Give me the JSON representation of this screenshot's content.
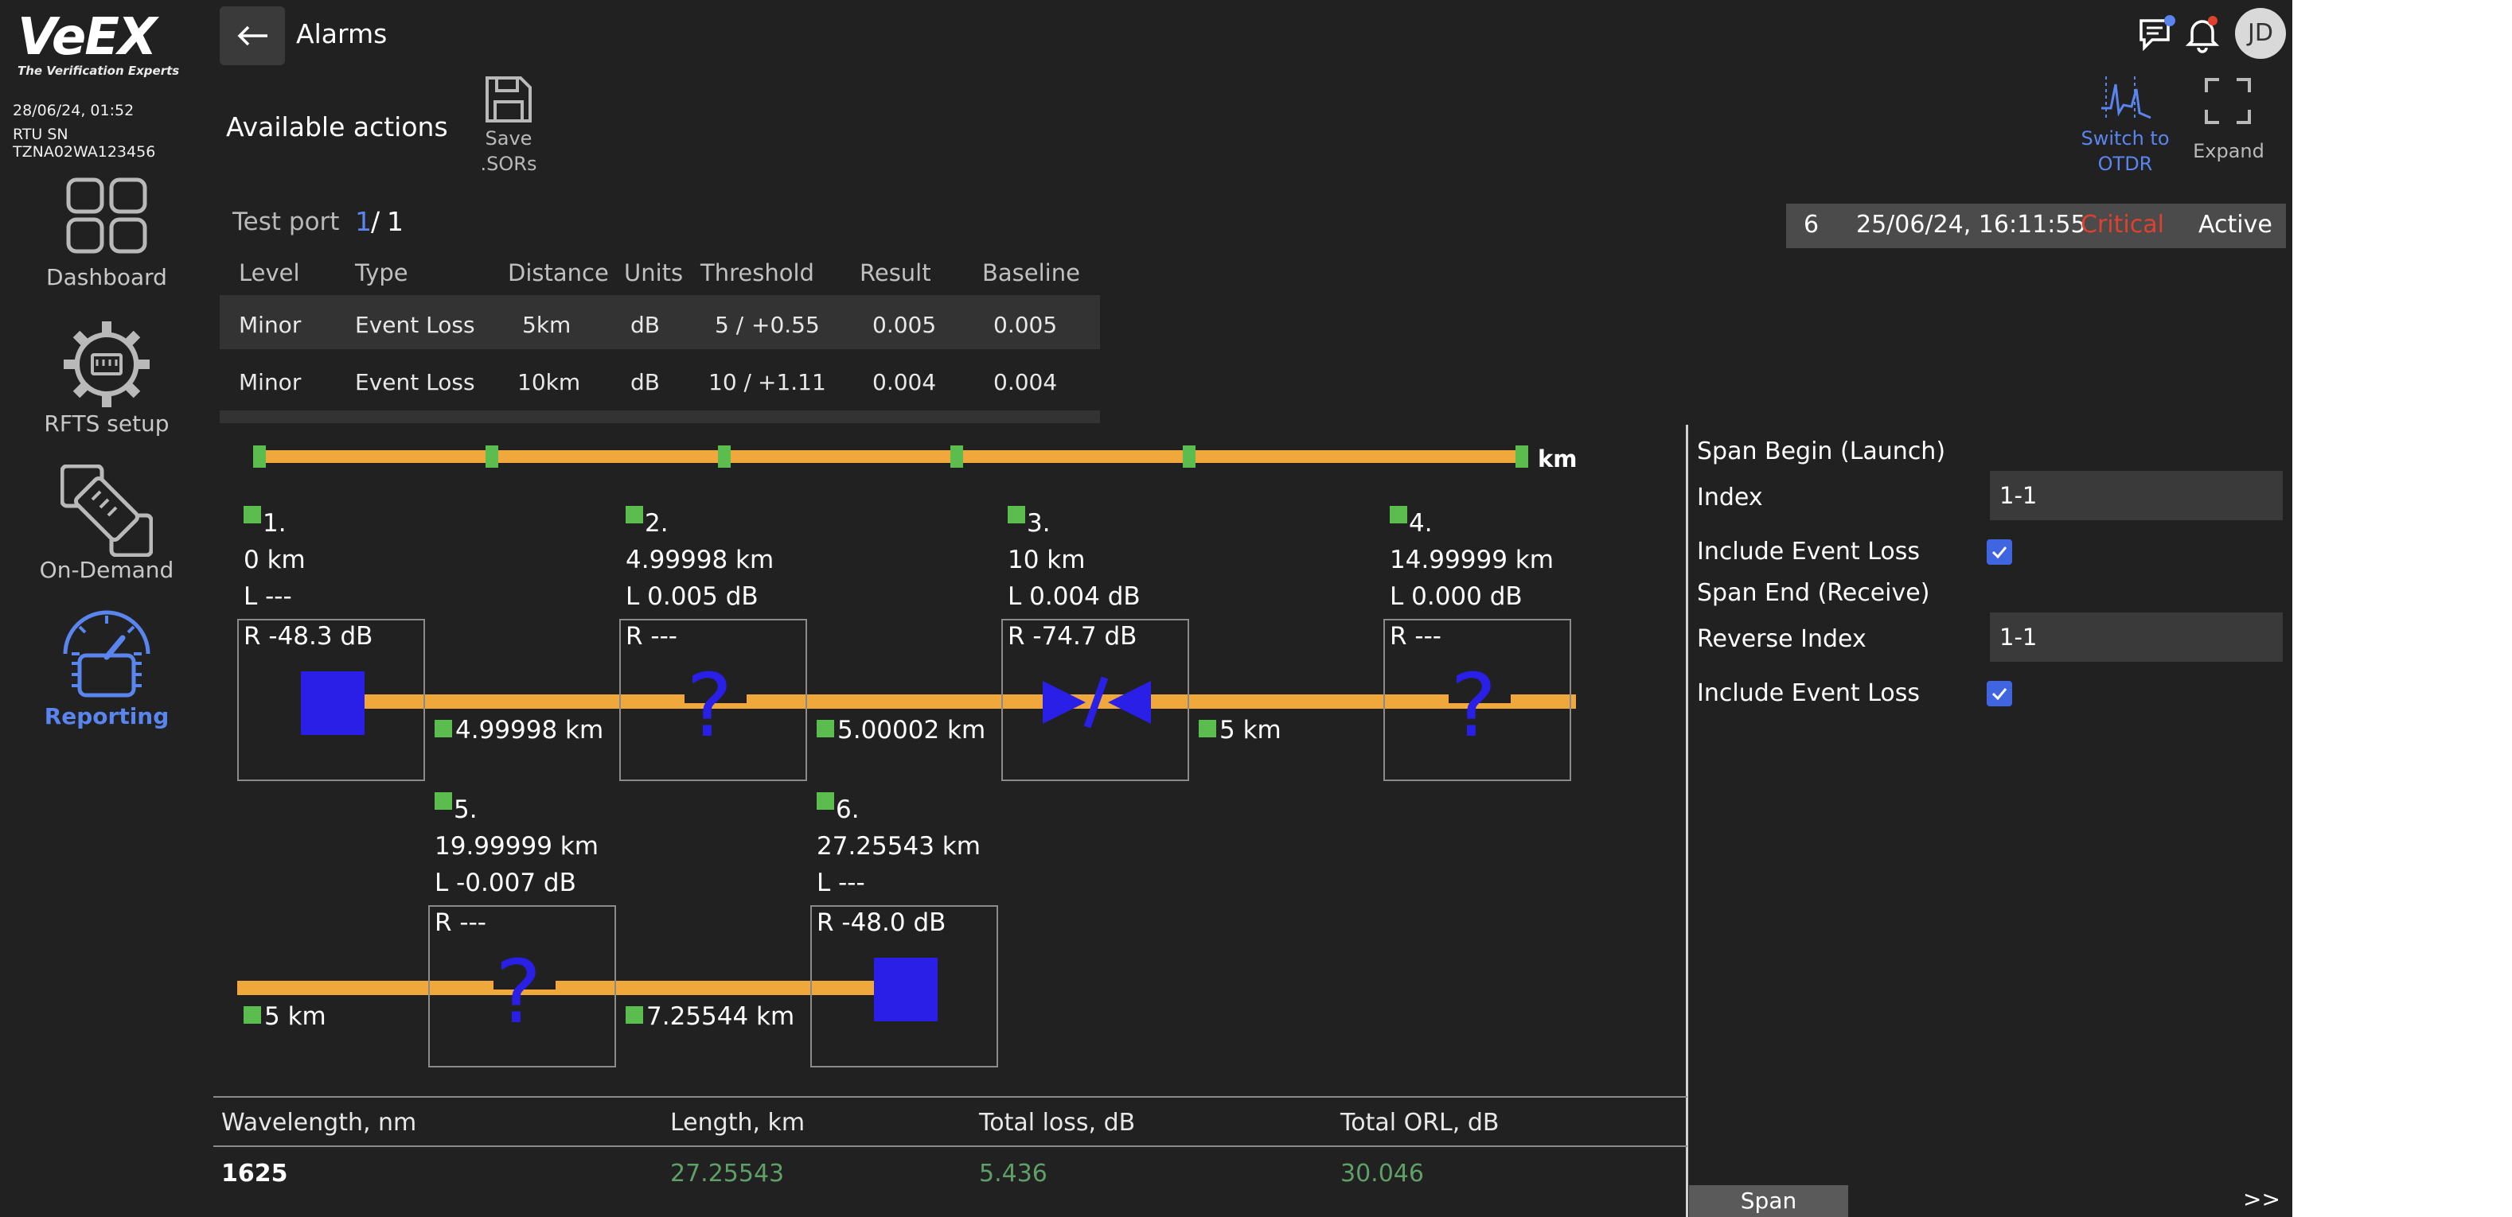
{
  "brand": {
    "logo": "VeEX",
    "tagline": "The Verification Experts"
  },
  "device": {
    "datetime": "28/06/24, 01:52",
    "serial": "RTU SN TZNA02WA123456"
  },
  "nav": [
    {
      "label": "Dashboard",
      "icon": "dashboard-icon"
    },
    {
      "label": "RFTS setup",
      "icon": "gear-icon"
    },
    {
      "label": "On-Demand",
      "icon": "on-demand-icon"
    },
    {
      "label": "Reporting",
      "icon": "speedometer-icon",
      "active": true
    }
  ],
  "header": {
    "back_icon": "arrow-left-icon",
    "title": "Alarms",
    "avatar": "JD"
  },
  "actions": {
    "title": "Available actions",
    "save_label_1": "Save",
    "save_label_2": ".SORs",
    "switch_label_1": "Switch to",
    "switch_label_2": "OTDR",
    "expand_label": "Expand"
  },
  "test_port": {
    "label": "Test port",
    "current": "1",
    "sep": "/",
    "total": "1"
  },
  "alarm_table": {
    "headers": [
      "Level",
      "Type",
      "Distance",
      "Units",
      "Threshold",
      "Result",
      "Baseline"
    ],
    "rows": [
      {
        "level": "Minor",
        "type": "Event Loss",
        "distance": "5km",
        "units": "dB",
        "threshold": "5 /",
        "delta": "+0.55",
        "result": "0.005",
        "baseline": "0.005"
      },
      {
        "level": "Minor",
        "type": "Event Loss",
        "distance": "10km",
        "units": "dB",
        "threshold": "10 /",
        "delta": "+1.11",
        "result": "0.004",
        "baseline": "0.004"
      }
    ]
  },
  "alarm_status": {
    "id": "6",
    "datetime": "25/06/24, 16:11:55",
    "severity": "Critical",
    "state": "Active"
  },
  "diagram": {
    "unit": "km",
    "events": [
      {
        "num": "1.",
        "distance": "0 km",
        "loss": "L ---",
        "refl": "R -48.3 dB"
      },
      {
        "num": "2.",
        "distance": "4.99998 km",
        "loss": "L 0.005 dB",
        "refl": "R ---"
      },
      {
        "num": "3.",
        "distance": "10 km",
        "loss": "L 0.004 dB",
        "refl": "R -74.7 dB"
      },
      {
        "num": "4.",
        "distance": "14.99999 km",
        "loss": "L 0.000 dB",
        "refl": "R ---"
      },
      {
        "num": "5.",
        "distance": "19.99999 km",
        "loss": "L -0.007 dB",
        "refl": "R ---"
      },
      {
        "num": "6.",
        "distance": "27.25543 km",
        "loss": "L ---",
        "refl": "R -48.0 dB"
      }
    ],
    "spans": [
      "4.99998 km",
      "5.00002 km",
      "5 km",
      "5 km",
      "7.25544 km"
    ]
  },
  "span_panel": {
    "begin_title": "Span Begin (Launch)",
    "index_label": "Index",
    "index_value": "1-1",
    "include_label_1": "Include Event Loss",
    "end_title": "Span End (Receive)",
    "reverse_label": "Reverse Index",
    "reverse_value": "1-1",
    "include_label_2": "Include Event Loss",
    "tab": "Span",
    "more": ">>"
  },
  "summary": {
    "headers": [
      "Wavelength, nm",
      "Length, km",
      "Total loss, dB",
      "Total ORL, dB"
    ],
    "values": [
      "1625",
      "27.25543",
      "5.436",
      "30.046"
    ]
  },
  "colors": {
    "background": "#212122",
    "accent": "#5a85ee",
    "warning": "#f1d650",
    "critical": "#e0412f",
    "fiber": "#f0a83c",
    "event_blue": "#2a1fe6",
    "marker_green": "#5bbd4e"
  }
}
